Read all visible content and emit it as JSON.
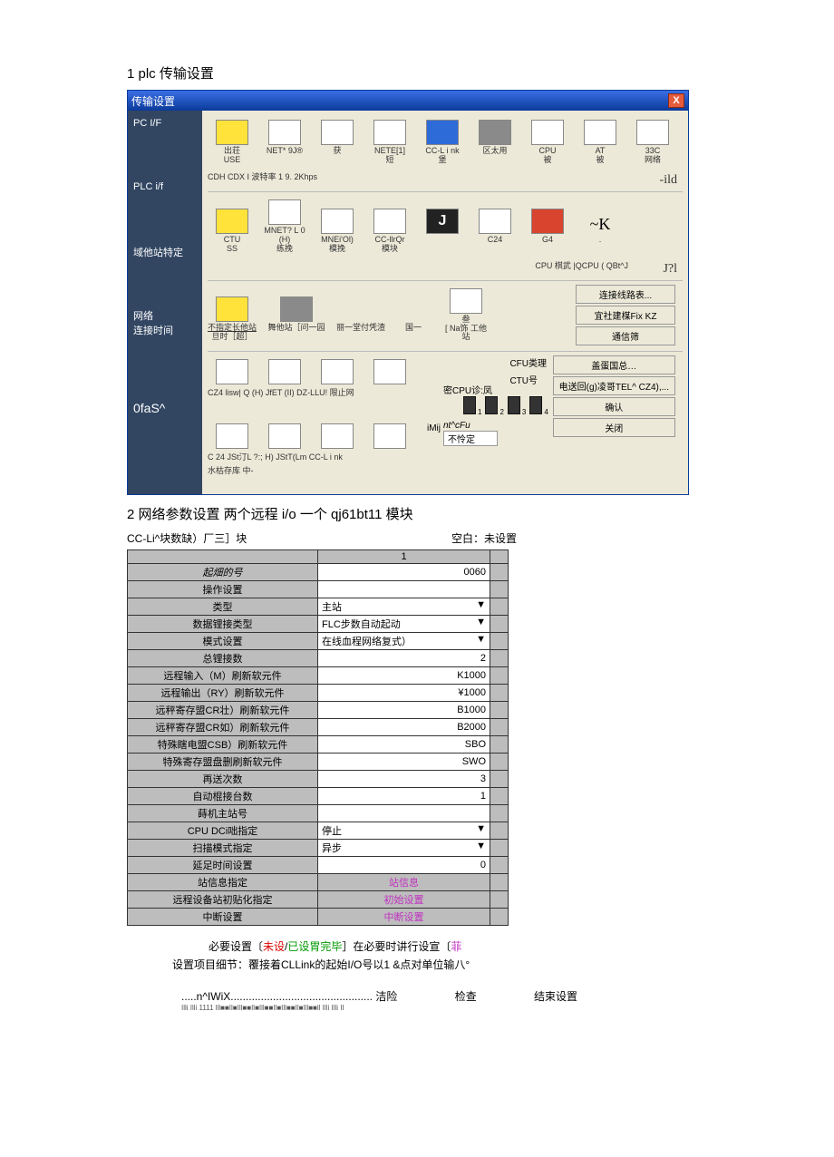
{
  "section1_title": "1 plc 传输设置",
  "win": {
    "title": "传输设置",
    "close": "X",
    "side": {
      "s1": "PC I/F",
      "s2": "PLC i/f",
      "s3": "域他站特定",
      "s4": "网络\n连接时间",
      "s5": "0faS^"
    },
    "row1": {
      "slots": [
        {
          "top": "出荘",
          "bot": "USE"
        },
        {
          "top": "NET* 9J®",
          "bot": ""
        },
        {
          "top": "",
          "bot": "获"
        },
        {
          "top": "NETE[1]",
          "bot": "短"
        },
        {
          "top": "CC-L i nk",
          "bot": "堡"
        },
        {
          "top": "区太用",
          "bot": ""
        },
        {
          "top": "CPU",
          "bot": "被"
        },
        {
          "top": "AT",
          "bot": "被"
        },
        {
          "top": "33C",
          "bot": "网络"
        }
      ],
      "tag": "-ild",
      "sub": "CDH    CDX I    波特率    1 9. 2Khps"
    },
    "row2": {
      "slots": [
        {
          "top": "CTU",
          "bot": "SS"
        },
        {
          "top": "MNET? L 0 (H)",
          "bot": "练挽"
        },
        {
          "top": "MNEi'Ol)",
          "bot": "模挽"
        },
        {
          "top": "CC-llrQr",
          "bot": "模块"
        },
        {
          "top": "■J",
          "bot": ""
        },
        {
          "top": "C24",
          "bot": ""
        },
        {
          "top": "G4",
          "bot": ""
        },
        {
          "top": "~K",
          "bot": "."
        }
      ],
      "tag": "J?l",
      "sub": "CPU 棋武  |QCPU ( QBt^J"
    },
    "row3": {
      "slots": [
        {
          "top": "不指定长他站",
          "bot": "旦时［超］"
        },
        {
          "top": "",
          "bot": "舞他站［问一园"
        },
        {
          "top": "",
          "bot": "丽一堂付凭渣"
        },
        {
          "top": "",
          "bot": "国一"
        },
        {
          "top": "叁",
          "bot": "[ Na饰 工他站"
        }
      ],
      "btns": [
        "连接线路表...",
        "宜社建楳Fix KZ",
        "通信筛"
      ]
    },
    "row4": {
      "sub": "CZ4 lisw| Q (H) JfET (II) DZ-LLU! 限止网",
      "lab1": "CFU类理［",
      "lab2": "CTU号",
      "lab3": "密CPU诊:凤",
      "btns": [
        "盖蛋国总…",
        "电送回(g)凌哥TEL^ CZ4),...",
        "确认",
        "关闭"
      ],
      "imij": "iMij",
      "dnum": [
        "1",
        "2",
        "3",
        "4"
      ],
      "nt": "nt^cFu",
      "nk": "不怜定",
      "sub2": "C 24          JSt汀L ?:;  H) JStT(Lm         CC-L i nk",
      "sub3": "水枯存库 中-"
    }
  },
  "section2_title": "2 网络参数设置 两个远程 i/o 一个 qj61bt11 模块",
  "tbl_caption_l": "CC-Li^块数缺）厂三］块",
  "tbl_caption_r": "空白：未设置",
  "tbl_head": "1",
  "rows": [
    {
      "k": "起畑的号",
      "v": "0060",
      "t": "v",
      "it": true
    },
    {
      "k": "操作设置",
      "v": "",
      "t": "v"
    },
    {
      "k": "类型",
      "v": "主站",
      "t": "sel"
    },
    {
      "k": "数据锂接类型",
      "v": "FLC步数自动起动",
      "t": "sel"
    },
    {
      "k": "模式设置",
      "v": "在线血程网络复式）",
      "t": "sel"
    },
    {
      "k": "总锂接数",
      "v": "2",
      "t": "v"
    },
    {
      "k": "远程输入（M）刷新软元件",
      "v": "K1000",
      "t": "v"
    },
    {
      "k": "远程输出（RY）刷新软元件",
      "v": "¥1000",
      "t": "v"
    },
    {
      "k": "远秤寄存盟CR壮）刷新软元件",
      "v": "B1000",
      "t": "v"
    },
    {
      "k": "远秤寄存盟CR如）刷新软元件",
      "v": "B2000",
      "t": "v"
    },
    {
      "k": "特殊瞎电盟CSB）刷新软元件",
      "v": "SBO",
      "t": "v"
    },
    {
      "k": "特殊寄存盟盘删刷新软元件",
      "v": "SWO",
      "t": "v"
    },
    {
      "k": "再送次数",
      "v": "3",
      "t": "v"
    },
    {
      "k": "自动棍接台数",
      "v": "1",
      "t": "v"
    },
    {
      "k": "蒔机主站号",
      "v": "",
      "t": "v"
    },
    {
      "k": "CPU DCi咄指定",
      "v": "停止",
      "t": "sel"
    },
    {
      "k": "扫描模式指定",
      "v": "异步",
      "t": "sel"
    },
    {
      "k": "延足时间设置",
      "v": "0",
      "t": "v"
    },
    {
      "k": "站信息指定",
      "v": "站信息",
      "t": "link"
    },
    {
      "k": "远程设备站初贴化指定",
      "v": "初始设置",
      "t": "link"
    },
    {
      "k": "中断设置",
      "v": "中断设置",
      "t": "link"
    }
  ],
  "note1_a": "必要设置〔",
  "note1_b": "未设",
  "note1_c": "/",
  "note1_d": "已设胃完毕",
  "note1_e": "］在必要时讲行设宣〔",
  "note1_f": "菲",
  "note2": "设置项目细节：覆接着CLLink的起始I/O号以1 &点对单位输八°",
  "foot_a": ".....n^IWiX............................................... 洁险",
  "foot_b": "检查",
  "foot_c": "结束设置",
  "foot_tiny": "Illi Illi 1111 lll■■Il■Ill■■Il■Ill■■Il■Ill■■Il■Ill■■ll Illi Illi II"
}
